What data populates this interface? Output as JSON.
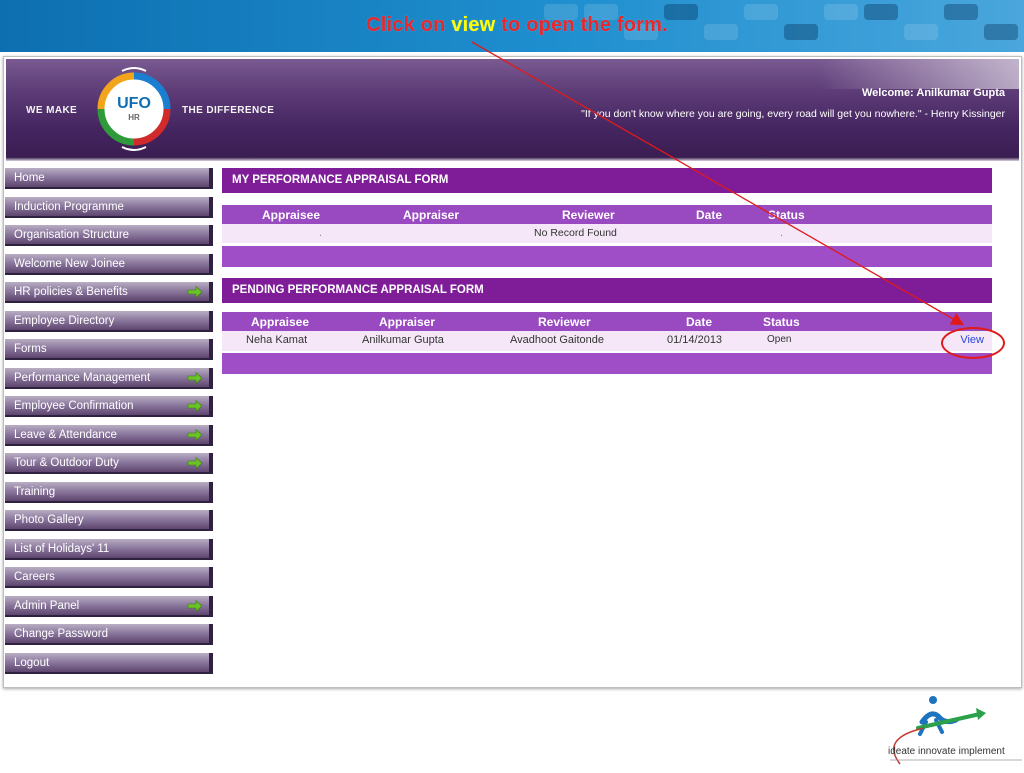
{
  "slide": {
    "instruction_prefix": "Click on ",
    "instruction_keyword": "view",
    "instruction_suffix": " to open the form."
  },
  "header": {
    "tagline_left": "WE MAKE",
    "tagline_right": "THE DIFFERENCE",
    "logo_text": "UFO",
    "logo_sub": "HR",
    "welcome": "Welcome: Anilkumar Gupta",
    "quote": "\"If you don't know where you are going, every road will get you nowhere.\" - Henry Kissinger"
  },
  "sidebar": {
    "items": [
      {
        "label": "Home",
        "arrow": false
      },
      {
        "label": "Induction Programme",
        "arrow": false
      },
      {
        "label": "Organisation Structure",
        "arrow": false
      },
      {
        "label": "Welcome New Joinee",
        "arrow": false
      },
      {
        "label": "HR policies & Benefits",
        "arrow": true
      },
      {
        "label": "Employee Directory",
        "arrow": false
      },
      {
        "label": "Forms",
        "arrow": false
      },
      {
        "label": "Performance Management",
        "arrow": true
      },
      {
        "label": "Employee Confirmation",
        "arrow": true
      },
      {
        "label": "Leave & Attendance",
        "arrow": true
      },
      {
        "label": "Tour & Outdoor Duty",
        "arrow": true
      },
      {
        "label": "Training",
        "arrow": false
      },
      {
        "label": "Photo Gallery",
        "arrow": false
      },
      {
        "label": "List of Holidays' 11",
        "arrow": false
      },
      {
        "label": "Careers",
        "arrow": false
      },
      {
        "label": "Admin Panel",
        "arrow": true
      },
      {
        "label": "Change Password",
        "arrow": false
      },
      {
        "label": "Logout",
        "arrow": false
      }
    ]
  },
  "my_form": {
    "title": "MY PERFORMANCE APPRAISAL FORM",
    "columns": [
      "Appraisee",
      "Appraiser",
      "Reviewer",
      "Date",
      "Status"
    ],
    "row": {
      "appraisee": ".",
      "reviewer": "No Record Found",
      "status": "."
    }
  },
  "pending_form": {
    "title": "PENDING PERFORMANCE APPRAISAL FORM",
    "columns": [
      "Appraisee",
      "Appraiser",
      "Reviewer",
      "Date",
      "Status"
    ],
    "row": {
      "appraisee": "Neha Kamat",
      "appraiser": "Anilkumar Gupta",
      "reviewer": "Avadhoot Gaitonde",
      "date": "01/14/2013",
      "status": "Open",
      "action": "View"
    }
  },
  "footer": {
    "tagline": "ideate innovate implement"
  },
  "colors": {
    "header_purple": "#452560",
    "section_title": "#7f1d98",
    "table_header": "#9a4ac0",
    "row_bg": "#f5e7f8",
    "link": "#2a45d8",
    "annotation_red": "#e01a1a",
    "nav_arrow_green": "#6dc22a"
  }
}
